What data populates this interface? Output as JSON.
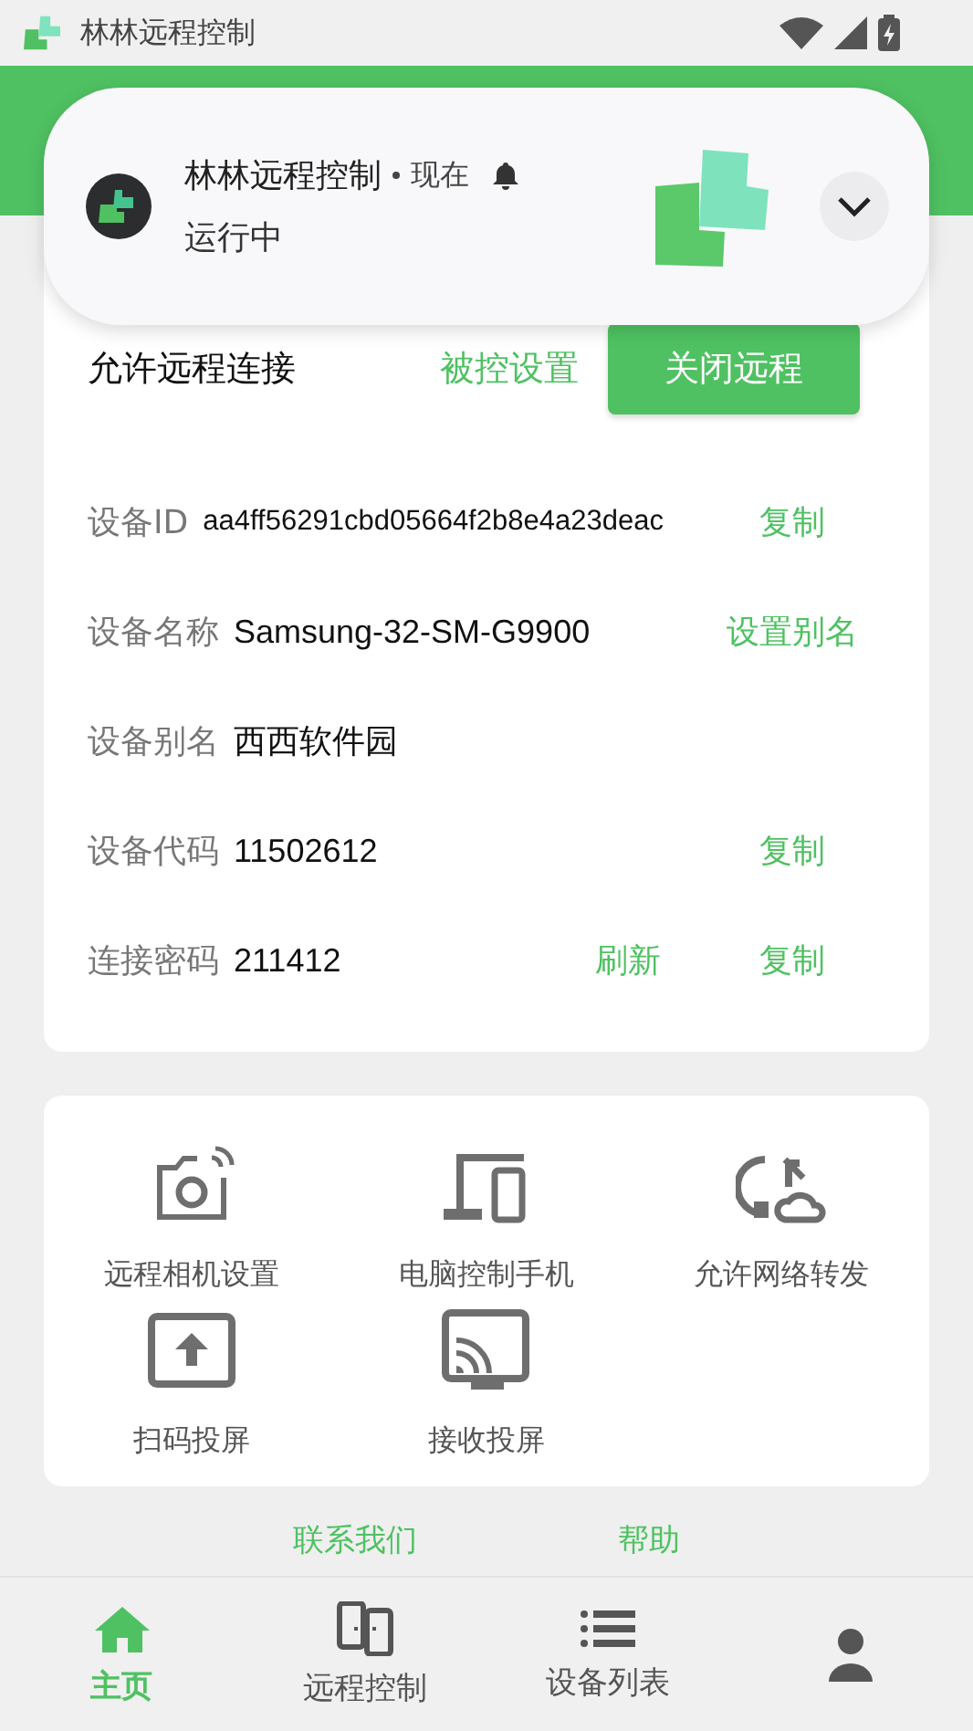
{
  "status_bar": {
    "app_name": "林林远程控制"
  },
  "notification": {
    "app_name": "林林远程控制",
    "time": "现在",
    "text": "运行中"
  },
  "remote": {
    "label": "允许远程连接",
    "link": "被控设置",
    "button": "关闭远程"
  },
  "info_rows": [
    {
      "label": "设备ID",
      "value": "aa4ff56291cbd05664f2b8e4a23deac",
      "actions": [
        "复制"
      ]
    },
    {
      "label": "设备名称",
      "value": "Samsung-32-SM-G9900",
      "actions": [
        "设置别名"
      ]
    },
    {
      "label": "设备别名",
      "value": "西西软件园",
      "actions": []
    },
    {
      "label": "设备代码",
      "value": "11502612",
      "actions": [
        "复制"
      ]
    },
    {
      "label": "连接密码",
      "value": "211412",
      "actions": [
        "刷新",
        "复制"
      ]
    }
  ],
  "features": [
    {
      "label": "远程相机设置",
      "kind": "camera"
    },
    {
      "label": "电脑控制手机",
      "kind": "devices"
    },
    {
      "label": "允许网络转发",
      "kind": "sync"
    },
    {
      "label": "扫码投屏",
      "kind": "upload"
    },
    {
      "label": "接收投屏",
      "kind": "cast"
    }
  ],
  "links": [
    "联系我们",
    "帮助"
  ],
  "tabs": [
    {
      "label": "主页",
      "kind": "home",
      "selected": true
    },
    {
      "label": "远程控制",
      "kind": "phones",
      "selected": false
    },
    {
      "label": "设备列表",
      "kind": "list",
      "selected": false
    },
    {
      "kind": "person",
      "selected": false
    }
  ]
}
